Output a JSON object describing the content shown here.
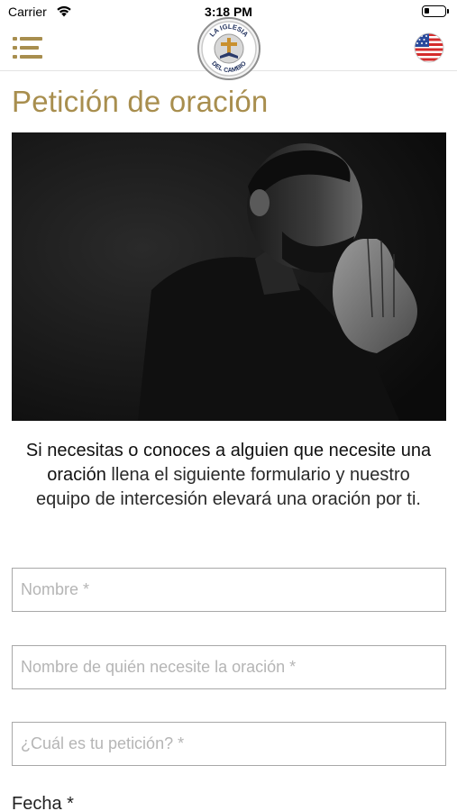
{
  "status_bar": {
    "carrier": "Carrier",
    "time": "3:18 PM",
    "icons": [
      "wifi-icon",
      "battery-icon"
    ]
  },
  "header": {
    "menu_icon": "menu-icon",
    "logo": {
      "top_text": "LA IGLESIA",
      "bottom_text": "DEL CAMBIO"
    },
    "language_icon": "us-flag-icon"
  },
  "page": {
    "title": "Petición de oración",
    "hero_image": "person-praying-photo",
    "intro_strong": "Si necesitas o conoces a alguien que necesite una oración",
    "intro_rest": " llena el siguiente formulario y nuestro equipo de intercesión elevará una oración por ti."
  },
  "form": {
    "name_placeholder": "Nombre *",
    "for_whom_placeholder": "Nombre de quién necesite la oración *",
    "request_placeholder": "¿Cuál es tu petición? *",
    "date_label": "Fecha *"
  },
  "colors": {
    "accent_gold": "#a88e4e",
    "border_gray": "#a8a8a8"
  }
}
